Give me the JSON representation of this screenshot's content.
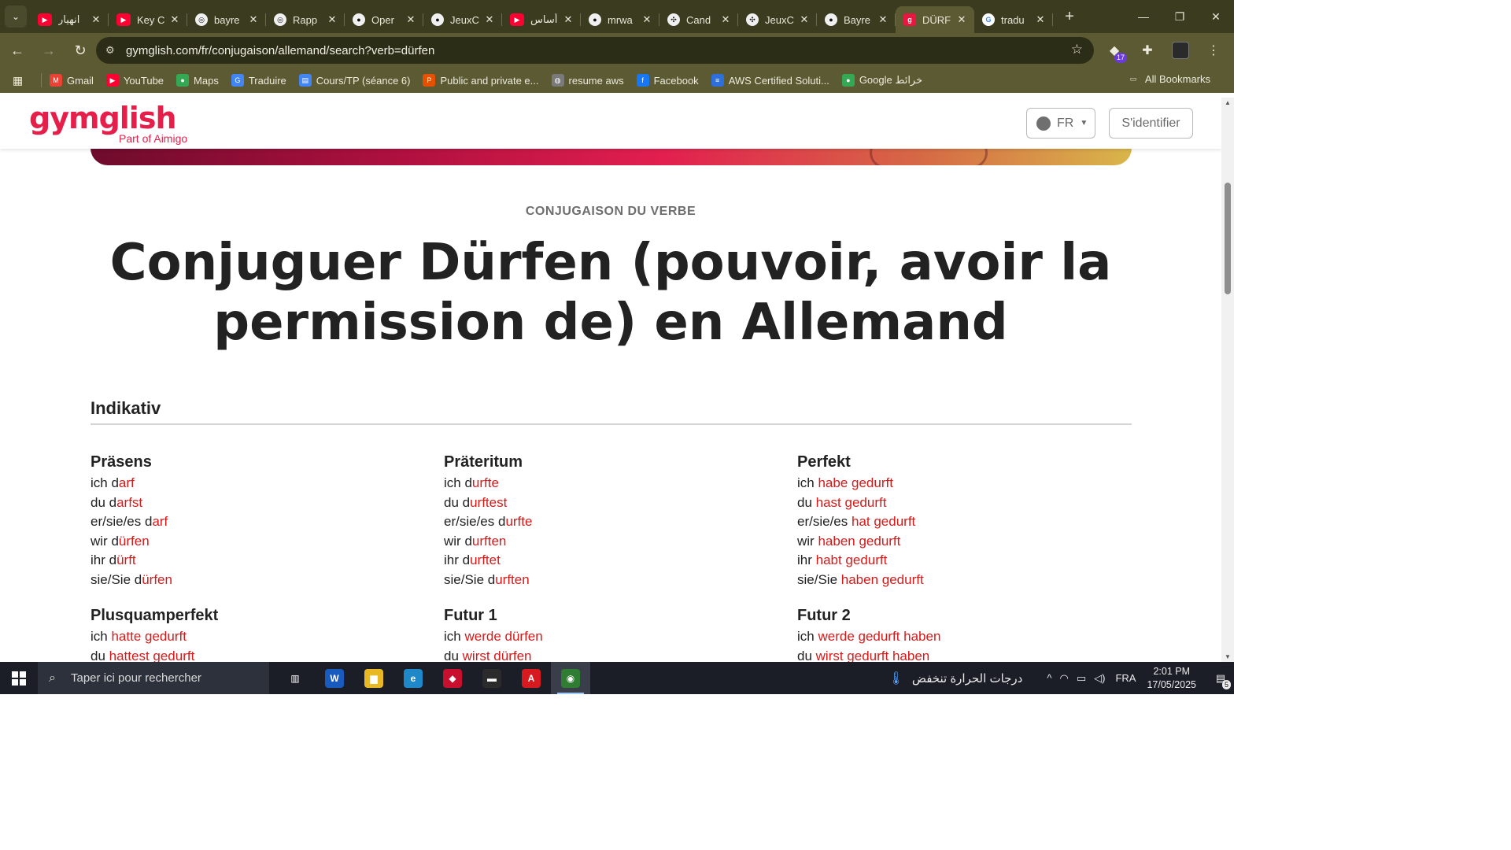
{
  "tabs": [
    {
      "title": "انهيار",
      "icon": "youtube-icon",
      "active": false
    },
    {
      "title": "Key C",
      "icon": "youtube-icon",
      "active": false
    },
    {
      "title": "bayre",
      "icon": "app-icon",
      "active": false
    },
    {
      "title": "Rapp",
      "icon": "app-icon",
      "active": false
    },
    {
      "title": "Oper",
      "icon": "github-icon",
      "active": false
    },
    {
      "title": "JeuxC",
      "icon": "github-icon",
      "active": false
    },
    {
      "title": "أساس",
      "icon": "youtube-icon",
      "active": false
    },
    {
      "title": "mrwa",
      "icon": "github-icon",
      "active": false
    },
    {
      "title": "Cand",
      "icon": "openai-icon",
      "active": false
    },
    {
      "title": "JeuxC",
      "icon": "openai-icon",
      "active": false
    },
    {
      "title": "Bayre",
      "icon": "github-icon",
      "active": false
    },
    {
      "title": "DÜRF",
      "icon": "gymglish-icon",
      "active": true
    },
    {
      "title": "tradu",
      "icon": "google-icon",
      "active": false
    }
  ],
  "toolbar": {
    "url": "gymglish.com/fr/conjugaison/allemand/search?verb=dürfen",
    "extensions_badge": "17"
  },
  "bookmarks": [
    {
      "label": "Gmail",
      "color": "#ea4335",
      "glyph": "M"
    },
    {
      "label": "YouTube",
      "color": "#ff0033",
      "glyph": "▶"
    },
    {
      "label": "Maps",
      "color": "#34a853",
      "glyph": "●"
    },
    {
      "label": "Traduire",
      "color": "#4285f4",
      "glyph": "G"
    },
    {
      "label": "Cours/TP (séance 6)",
      "color": "#4285f4",
      "glyph": "▤"
    },
    {
      "label": "Public and private e...",
      "color": "#e65100",
      "glyph": "P"
    },
    {
      "label": "resume aws",
      "color": "#7a7a7a",
      "glyph": "◍"
    },
    {
      "label": "Facebook",
      "color": "#1877f2",
      "glyph": "f"
    },
    {
      "label": "AWS Certified Soluti...",
      "color": "#2d6fdb",
      "glyph": "≡"
    },
    {
      "label": "Google خرائط",
      "color": "#34a853",
      "glyph": "●"
    }
  ],
  "bookmarks_all": "All Bookmarks",
  "site": {
    "logo": "gymglish",
    "logo_sub": "Part of Aimigo",
    "lang": "FR",
    "login": "S'identifier"
  },
  "content": {
    "eyebrow": "CONJUGAISON DU VERBE",
    "title_line1": "Conjuguer Dürfen (pouvoir, avoir la",
    "title_line2": "permission de) en Allemand",
    "section": "Indikativ"
  },
  "tenses": [
    {
      "name": "Präsens",
      "rows": [
        {
          "p": "ich d",
          "f": "arf"
        },
        {
          "p": "du d",
          "f": "arfst"
        },
        {
          "p": "er/sie/es d",
          "f": "arf"
        },
        {
          "p": "wir d",
          "f": "ürfen"
        },
        {
          "p": "ihr d",
          "f": "ürft"
        },
        {
          "p": "sie/Sie d",
          "f": "ürfen"
        }
      ]
    },
    {
      "name": "Präteritum",
      "rows": [
        {
          "p": "ich d",
          "f": "urfte"
        },
        {
          "p": "du d",
          "f": "urftest"
        },
        {
          "p": "er/sie/es d",
          "f": "urfte"
        },
        {
          "p": "wir d",
          "f": "urften"
        },
        {
          "p": "ihr d",
          "f": "urftet"
        },
        {
          "p": "sie/Sie d",
          "f": "urften"
        }
      ]
    },
    {
      "name": "Perfekt",
      "rows": [
        {
          "p": "ich ",
          "f": "habe gedurft"
        },
        {
          "p": "du ",
          "f": "hast gedurft"
        },
        {
          "p": "er/sie/es ",
          "f": "hat gedurft"
        },
        {
          "p": "wir ",
          "f": "haben gedurft"
        },
        {
          "p": "ihr ",
          "f": "habt gedurft"
        },
        {
          "p": "sie/Sie ",
          "f": "haben gedurft"
        }
      ]
    },
    {
      "name": "Plusquamperfekt",
      "rows": [
        {
          "p": "ich ",
          "f": "hatte gedurft"
        },
        {
          "p": "du ",
          "f": "hattest gedurft"
        }
      ]
    },
    {
      "name": "Futur 1",
      "rows": [
        {
          "p": "ich ",
          "f": "werde dürfen"
        },
        {
          "p": "du ",
          "f": "wirst dürfen"
        }
      ]
    },
    {
      "name": "Futur 2",
      "rows": [
        {
          "p": "ich ",
          "f": "werde gedurft haben"
        },
        {
          "p": "du ",
          "f": "wirst gedurft haben"
        }
      ]
    }
  ],
  "taskbar": {
    "search_placeholder": "Taper ici pour rechercher",
    "apps": [
      {
        "name": "task-view-app",
        "glyph": "▥",
        "color": "#1b1e27"
      },
      {
        "name": "word-app",
        "glyph": "W",
        "color": "#185abd"
      },
      {
        "name": "file-explorer-app",
        "glyph": "▆",
        "color": "#e8b923"
      },
      {
        "name": "edge-app",
        "glyph": "e",
        "color": "#1e88c8"
      },
      {
        "name": "red-app",
        "glyph": "◆",
        "color": "#c8102e"
      },
      {
        "name": "terminal-app",
        "glyph": "▬",
        "color": "#2b2b2b"
      },
      {
        "name": "acrobat-app",
        "glyph": "A",
        "color": "#d71920"
      },
      {
        "name": "chrome-app",
        "glyph": "◉",
        "color": "#2e7d32"
      }
    ],
    "weather": "درجات الحرارة تنخفض",
    "lang": "FRA",
    "time": "2:01 PM",
    "date": "17/05/2025",
    "notifications": "5"
  }
}
